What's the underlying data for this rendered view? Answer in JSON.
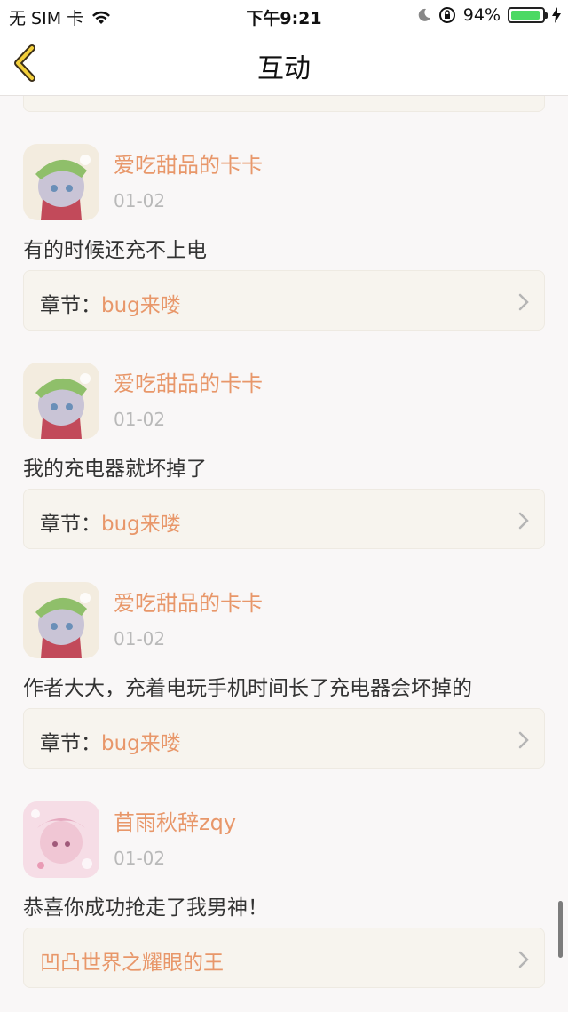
{
  "status": {
    "carrier": "无 SIM 卡",
    "time": "下午9:21",
    "battery": "94%",
    "battery_level": 0.94
  },
  "nav": {
    "title": "互动",
    "back_icon": "chevron-left-icon"
  },
  "chapter_prefix": "章节：",
  "comments": [
    {
      "user": "爱吃甜品的卡卡",
      "date": "01-02",
      "text": "有的时候还充不上电",
      "chapter": "bug来喽"
    },
    {
      "user": "爱吃甜品的卡卡",
      "date": "01-02",
      "text": "我的充电器就坏掉了",
      "chapter": "bug来喽"
    },
    {
      "user": "爱吃甜品的卡卡",
      "date": "01-02",
      "text": "作者大大，充着电玩手机时间长了充电器会坏掉的",
      "chapter": "bug来喽"
    },
    {
      "user": "苜雨秋辞zqy",
      "date": "01-02",
      "text": "恭喜你成功抢走了我男神！",
      "chapter": "凹凸世界之耀眼的王"
    }
  ],
  "colors": {
    "accent": "#e8976a",
    "card": "#f7f4ee",
    "text": "#333333",
    "date": "#b9b9b9"
  }
}
